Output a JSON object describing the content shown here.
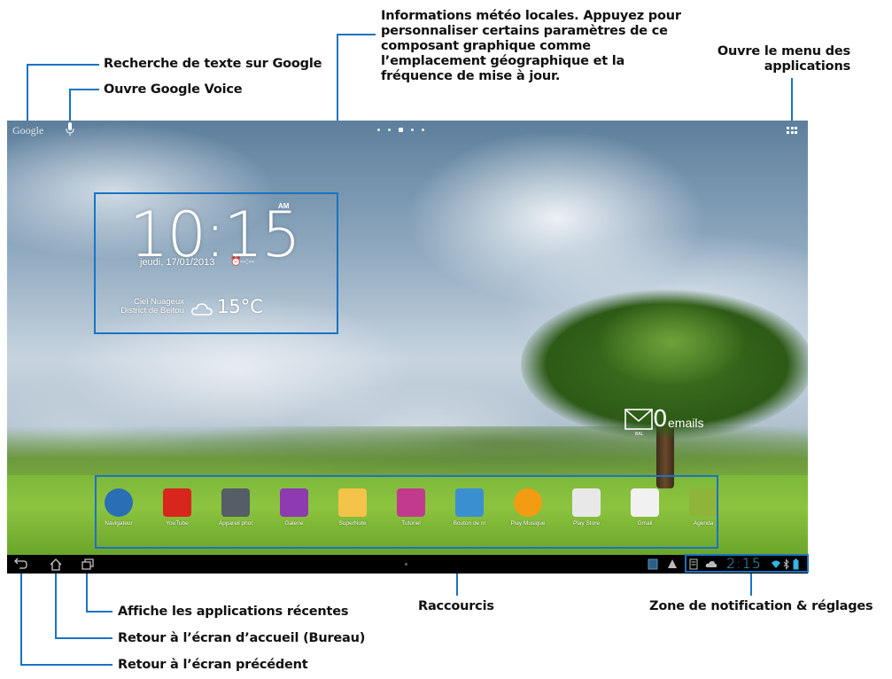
{
  "annotations": {
    "google_search": "Recherche de texte sur Google",
    "google_voice": "Ouvre Google Voice",
    "weather_info": "Informations météo locales. Appuyez pour personnaliser certains paramètres de ce composant graphique comme l’emplacement géographique et la fréquence de mise à jour.",
    "apps_menu": "Ouvre le menu des applications",
    "recent_apps": "Affiche les applications récentes",
    "home": "Retour à l’écran d’accueil (Bureau)",
    "back": "Retour à l’écran précédent",
    "shortcuts": "Raccourcis",
    "notification_area": "Zone de notification & réglages"
  },
  "screen": {
    "google_logo": "Google",
    "clock": {
      "time": "10:15",
      "ampm": "AM",
      "date": "jeudi, 17/01/2013",
      "alarm": "--:--"
    },
    "weather": {
      "condition": "Ciel Nuageux",
      "location": "District de Beitou",
      "temperature": "15°C"
    },
    "email": {
      "count": "0",
      "label": "emails",
      "icon_caption": "BAL"
    },
    "dock": [
      {
        "label": "Navigateur",
        "icon": "globe-icon",
        "color": "#2a6fb5"
      },
      {
        "label": "YouTube",
        "icon": "youtube-icon",
        "color": "#d8261c"
      },
      {
        "label": "Appareil phot",
        "icon": "camera-icon",
        "color": "#555d66"
      },
      {
        "label": "Galerie",
        "icon": "gallery-icon",
        "color": "#8e3ab0"
      },
      {
        "label": "SuperNote",
        "icon": "notepad-icon",
        "color": "#f3c34a"
      },
      {
        "label": "Tutoriel",
        "icon": "gift-icon",
        "color": "#c23a8e"
      },
      {
        "label": "Bouton de m",
        "icon": "widget-icon",
        "color": "#3a8fd1"
      },
      {
        "label": "Play Musique",
        "icon": "headphones-icon",
        "color": "#f39c12"
      },
      {
        "label": "Play Store",
        "icon": "play-store-icon",
        "color": "#e8e8e8"
      },
      {
        "label": "Gmail",
        "icon": "gmail-icon",
        "color": "#f1f1f1"
      },
      {
        "label": "Agenda",
        "icon": "calendar-icon",
        "color": "#8fb43a"
      }
    ],
    "status": {
      "time": "2:15"
    }
  },
  "colors": {
    "accent": "#1a73c4",
    "status_time": "#33b5e5"
  }
}
